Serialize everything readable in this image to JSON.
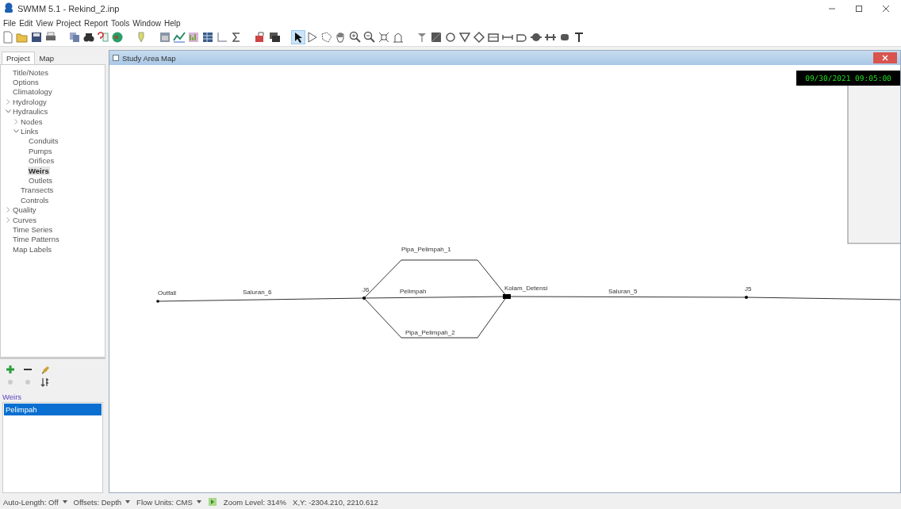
{
  "window": {
    "title": "SWMM 5.1 - Rekind_2.inp"
  },
  "menu": [
    "File",
    "Edit",
    "View",
    "Project",
    "Report",
    "Tools",
    "Window",
    "Help"
  ],
  "browser": {
    "tabs": [
      {
        "label": "Project",
        "selected": true
      },
      {
        "label": "Map",
        "selected": false
      }
    ],
    "tree": [
      {
        "label": "Title/Notes",
        "selected": false
      },
      {
        "label": "Options",
        "selected": false
      },
      {
        "label": "Climatology",
        "selected": false
      },
      {
        "label": "Hydrology",
        "selected": false,
        "expanded": false
      },
      {
        "label": "Hydraulics",
        "selected": false,
        "expanded": true,
        "children": [
          {
            "label": "Nodes",
            "selected": false,
            "expanded": false
          },
          {
            "label": "Links",
            "selected": false,
            "expanded": true,
            "children": [
              {
                "label": "Conduits",
                "selected": false
              },
              {
                "label": "Pumps",
                "selected": false
              },
              {
                "label": "Orifices",
                "selected": false
              },
              {
                "label": "Weirs",
                "selected": true
              },
              {
                "label": "Outlets",
                "selected": false
              }
            ]
          },
          {
            "label": "Transects",
            "selected": false
          },
          {
            "label": "Controls",
            "selected": false
          }
        ]
      },
      {
        "label": "Quality",
        "selected": false,
        "expanded": false
      },
      {
        "label": "Curves",
        "selected": false,
        "expanded": false
      },
      {
        "label": "Time Series",
        "selected": false
      },
      {
        "label": "Time Patterns",
        "selected": false
      },
      {
        "label": "Map Labels",
        "selected": false
      }
    ],
    "object_type": "Weirs",
    "objects": [
      {
        "label": "Pelimpah",
        "selected": true
      }
    ]
  },
  "map": {
    "title": "Study Area Map",
    "clock": "09/30/2021 09:05:00",
    "nodes": [
      {
        "label": "Outfall",
        "kind": "outfall"
      },
      {
        "label": "J6",
        "kind": "junction"
      },
      {
        "label": "Kolam_Detensi",
        "kind": "storage"
      },
      {
        "label": "J5",
        "kind": "junction"
      }
    ],
    "links": [
      {
        "label": "Saluran_6"
      },
      {
        "label": "Pipa_Pelimpah_1"
      },
      {
        "label": "Pelimpah"
      },
      {
        "label": "Pipa_Pelimpah_2"
      },
      {
        "label": "Saluran_5"
      }
    ]
  },
  "status_bar": [
    {
      "text": "Auto-Length: Off",
      "dropdown": true
    },
    {
      "text": "Offsets: Depth",
      "dropdown": true
    },
    {
      "text": "Flow Units: CMS",
      "dropdown": true
    },
    {
      "text": "Zoom Level: 314%",
      "dropdown": false
    },
    {
      "text": "X,Y: -2304.210, 2210.612",
      "dropdown": false
    }
  ]
}
